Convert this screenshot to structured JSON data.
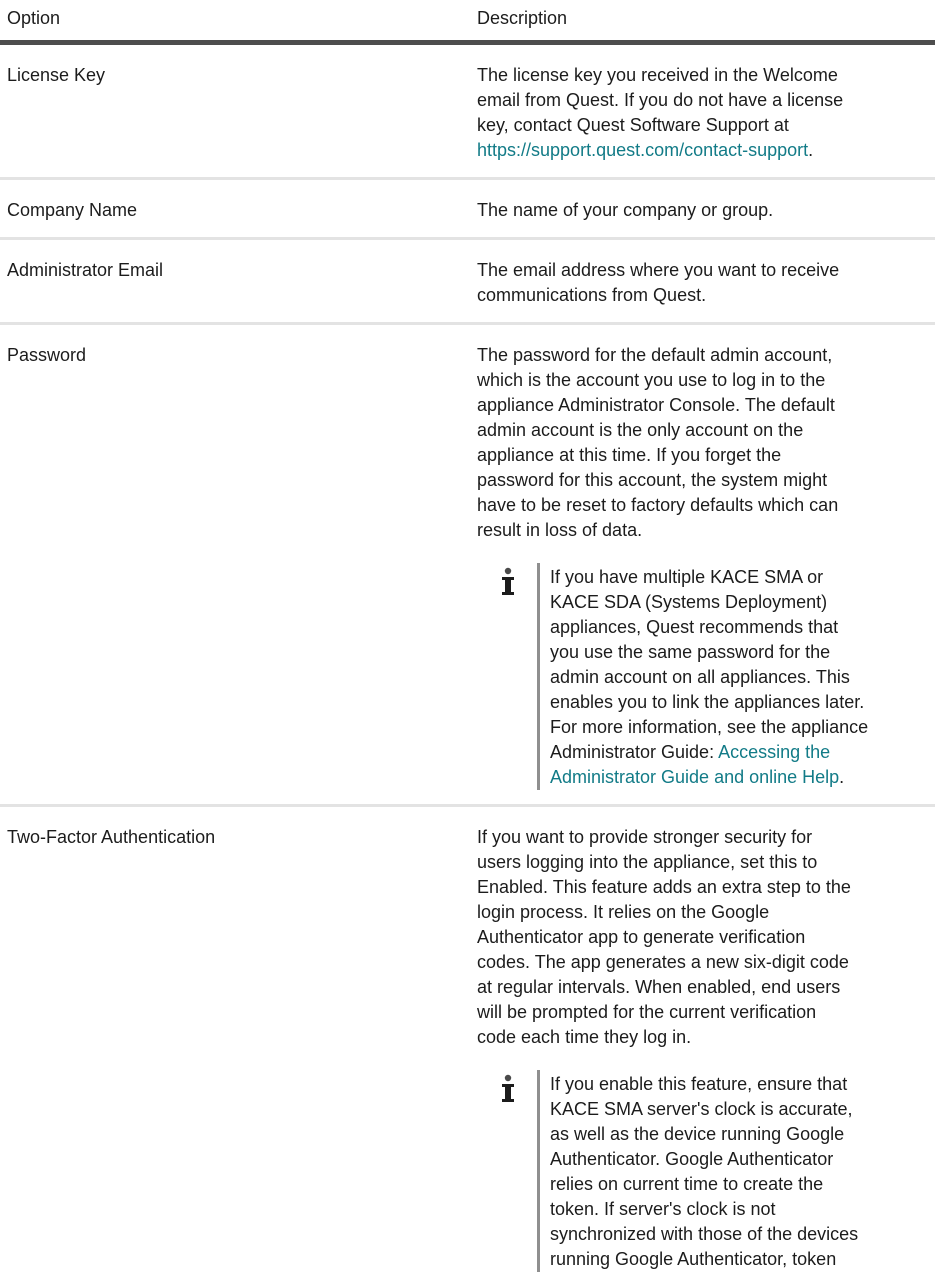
{
  "header": {
    "option": "Option",
    "description": "Description"
  },
  "rows": [
    {
      "option": "License Key",
      "desc_before": "The license key you received in the Welcome email from Quest. If you do not have a license key, contact Quest Software Support at ",
      "link": "https://support.quest.com/contact-support",
      "desc_after": "."
    },
    {
      "option": "Company Name",
      "desc": "The name of your company or group."
    },
    {
      "option": "Administrator Email",
      "desc": "The email address where you want to receive communications from Quest."
    },
    {
      "option": "Password",
      "desc": "The password for the default admin account, which is the account you use to log in to the appliance Administrator Console. The default admin account is the only account on the appliance at this time. If you forget the password for this account, the system might have to be reset to factory defaults which can result in loss of data.",
      "note_before": "If you have multiple KACE SMA or KACE SDA (Systems Deployment) appliances, Quest recommends that you use the same password for the admin account on all appliances. This enables you to link the appliances later. For more information, see the appliance Administrator Guide: ",
      "note_link": "Accessing the Administrator Guide and online Help",
      "note_after": "."
    },
    {
      "option": "Two-Factor Authentication",
      "desc": "If you want to provide stronger security for users logging into the appliance, set this to Enabled. This feature adds an extra step to the login process. It relies on the Google Authenticator app to generate verification codes. The app generates a new six-digit code at regular intervals. When enabled, end users will be prompted for the current verification code each time they log in.",
      "note": "If you enable this feature, ensure that KACE SMA server's clock is accurate, as well as the device running Google Authenticator. Google Authenticator relies on current time to create the token. If server's clock is not synchronized with those of the devices running Google Authenticator, token"
    }
  ],
  "icons": {
    "note": "info-icon"
  },
  "colors": {
    "link": "#127b87",
    "header_rule": "#4d4d4d",
    "row_rule": "#e3e3e3"
  }
}
